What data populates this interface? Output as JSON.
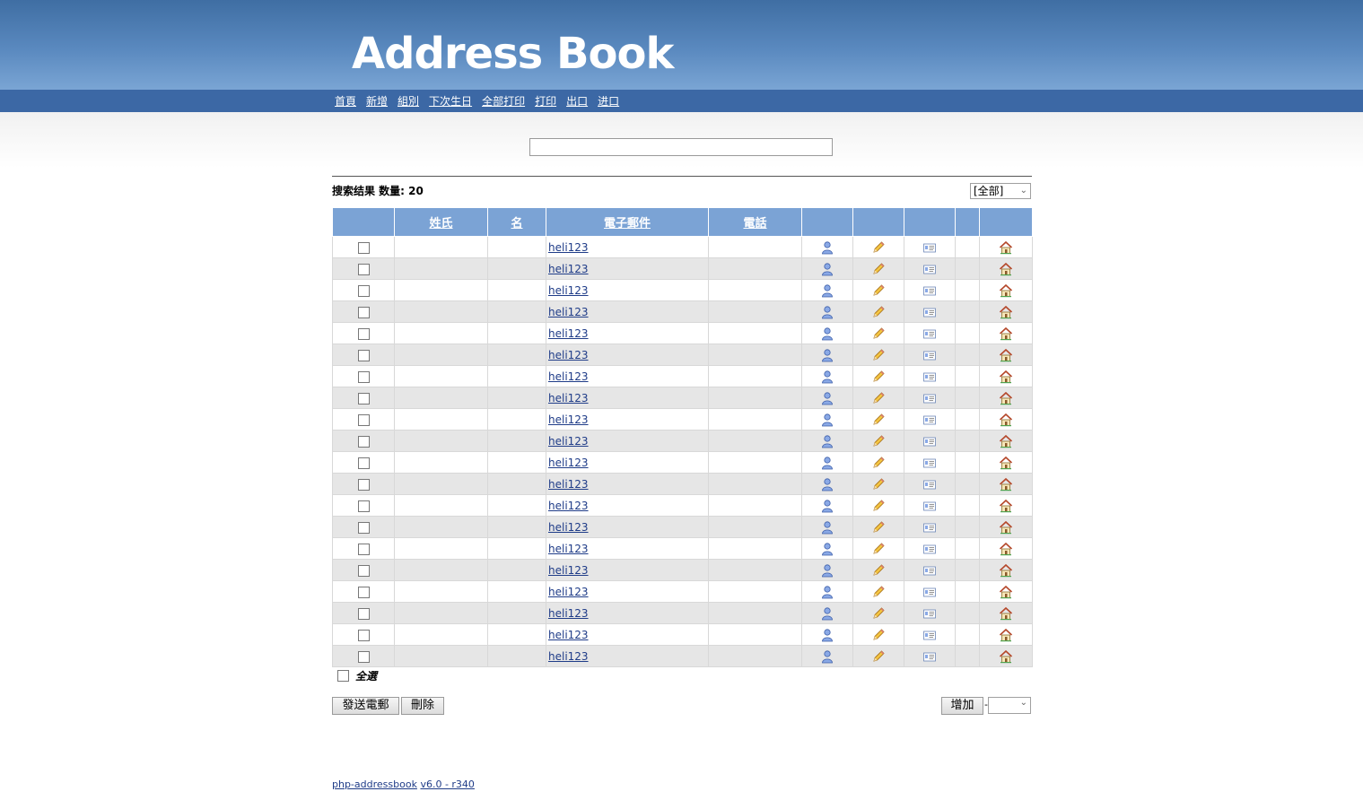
{
  "header": {
    "title": "Address Book"
  },
  "nav": {
    "items": [
      {
        "label": "首頁"
      },
      {
        "label": "新增"
      },
      {
        "label": "組別"
      },
      {
        "label": "下次生日"
      },
      {
        "label": "全部打印"
      },
      {
        "label": "打印"
      },
      {
        "label": "出口"
      },
      {
        "label": "进口"
      }
    ]
  },
  "search": {
    "value": ""
  },
  "results": {
    "count_label": "搜索结果 数量: 20",
    "group_select_value": "[全部]"
  },
  "table": {
    "headers": [
      "",
      "姓氏",
      "名",
      "電子郵件",
      "電話",
      "",
      "",
      "",
      "",
      ""
    ],
    "rows": [
      {
        "lastname": "",
        "firstname": "",
        "email": "heli123",
        "phone": ""
      },
      {
        "lastname": "",
        "firstname": "",
        "email": "heli123",
        "phone": ""
      },
      {
        "lastname": "",
        "firstname": "",
        "email": "heli123",
        "phone": ""
      },
      {
        "lastname": "",
        "firstname": "",
        "email": "heli123",
        "phone": ""
      },
      {
        "lastname": "",
        "firstname": "",
        "email": "heli123",
        "phone": ""
      },
      {
        "lastname": "",
        "firstname": "",
        "email": "heli123",
        "phone": ""
      },
      {
        "lastname": "",
        "firstname": "",
        "email": "heli123",
        "phone": ""
      },
      {
        "lastname": "",
        "firstname": "",
        "email": "heli123",
        "phone": ""
      },
      {
        "lastname": "",
        "firstname": "",
        "email": "heli123",
        "phone": ""
      },
      {
        "lastname": "",
        "firstname": "",
        "email": "heli123",
        "phone": ""
      },
      {
        "lastname": "",
        "firstname": "",
        "email": "heli123",
        "phone": ""
      },
      {
        "lastname": "",
        "firstname": "",
        "email": "heli123",
        "phone": ""
      },
      {
        "lastname": "",
        "firstname": "",
        "email": "heli123",
        "phone": ""
      },
      {
        "lastname": "",
        "firstname": "",
        "email": "heli123",
        "phone": ""
      },
      {
        "lastname": "",
        "firstname": "",
        "email": "heli123",
        "phone": ""
      },
      {
        "lastname": "",
        "firstname": "",
        "email": "heli123",
        "phone": ""
      },
      {
        "lastname": "",
        "firstname": "",
        "email": "heli123",
        "phone": ""
      },
      {
        "lastname": "",
        "firstname": "",
        "email": "heli123",
        "phone": ""
      },
      {
        "lastname": "",
        "firstname": "",
        "email": "heli123",
        "phone": ""
      },
      {
        "lastname": "",
        "firstname": "",
        "email": "heli123",
        "phone": ""
      }
    ],
    "row_icons": [
      "details-person-icon",
      "edit-pencil-icon",
      "vcard-icon",
      "homepage-house-icon"
    ]
  },
  "select_all": {
    "label": "全選"
  },
  "actions": {
    "send_email_label": "發送電郵",
    "delete_label": "刪除",
    "add_label": "增加",
    "add_select_value": ""
  },
  "footer": {
    "app_link": "php-addressbook",
    "version_link": "v6.0 - r340"
  },
  "colors": {
    "header_top": "#3f6ea3",
    "nav_bar": "#3c68a5",
    "table_header": "#7ba3d5",
    "row_alt": "#e6e6e6",
    "link": "#1f3c88"
  }
}
